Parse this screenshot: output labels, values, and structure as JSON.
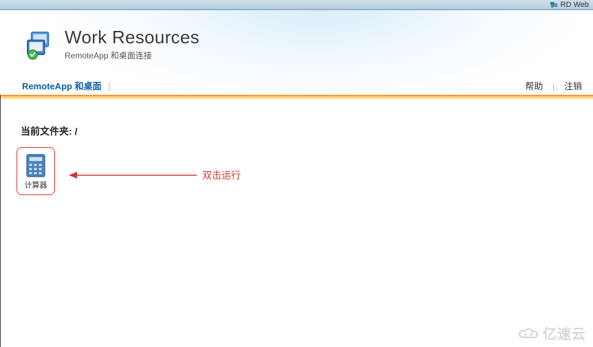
{
  "window": {
    "title": "RD Web"
  },
  "header": {
    "title": "Work Resources",
    "subtitle": "RemoteApp 和桌面连接"
  },
  "nav": {
    "active": "RemoteApp 和桌面",
    "help": "帮助",
    "signup": "注销"
  },
  "content": {
    "folder_label_prefix": "当前文件夹:",
    "folder_path": "/"
  },
  "apps": [
    {
      "name": "calculator",
      "label": "计算器"
    }
  ],
  "annotation": {
    "text": "双击运行"
  },
  "watermark": {
    "text": "亿速云"
  }
}
